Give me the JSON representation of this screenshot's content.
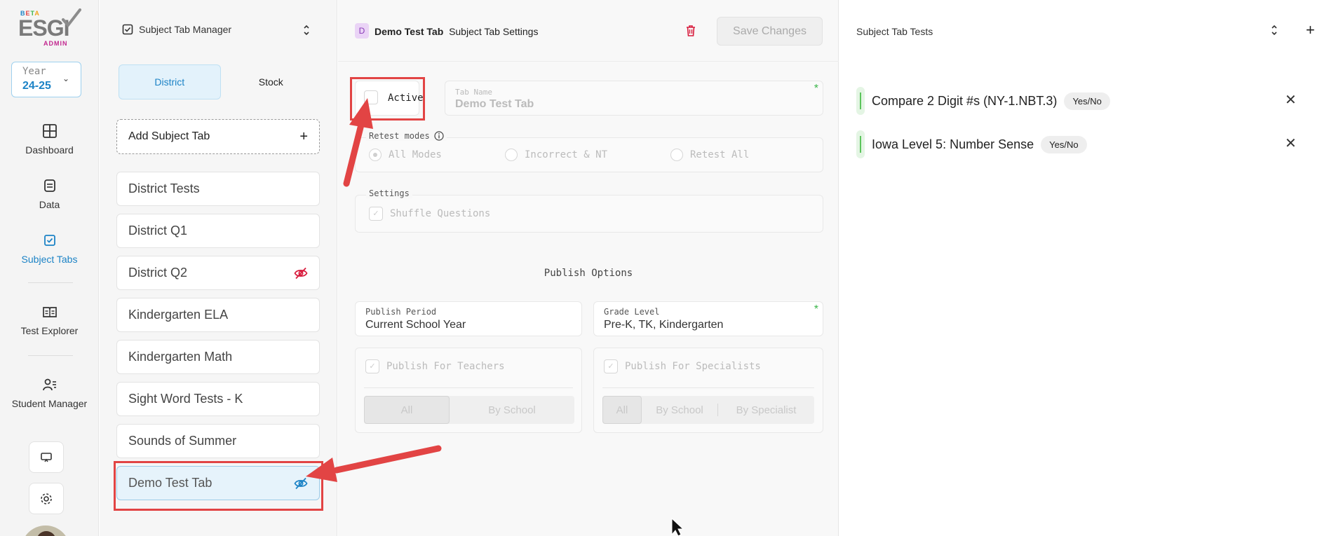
{
  "logo": {
    "beta": "BETA",
    "brand": "ESGI",
    "admin": "ADMIN"
  },
  "year": {
    "label": "Year",
    "value": "24-25"
  },
  "nav": {
    "dashboard": "Dashboard",
    "data": "Data",
    "subject_tabs": "Subject Tabs",
    "test_explorer": "Test Explorer",
    "student_manager": "Student Manager"
  },
  "list_panel": {
    "title": "Subject Tab Manager",
    "segments": {
      "district": "District",
      "stock": "Stock"
    },
    "add_label": "Add Subject Tab",
    "add_icon": "+",
    "items": [
      {
        "label": "District Tests",
        "hidden": false
      },
      {
        "label": "District Q1",
        "hidden": false
      },
      {
        "label": "District Q2",
        "hidden": true
      },
      {
        "label": "Kindergarten ELA",
        "hidden": false
      },
      {
        "label": "Kindergarten Math",
        "hidden": false
      },
      {
        "label": "Sight Word Tests - K",
        "hidden": false
      },
      {
        "label": "Sounds of Summer",
        "hidden": false
      },
      {
        "label": "Demo Test Tab",
        "hidden": true,
        "selected": true
      }
    ]
  },
  "settings": {
    "badge": "D",
    "tab_name": "Demo Test Tab",
    "header_suffix": "Subject Tab Settings",
    "save_label": "Save Changes",
    "active_label": "Active",
    "tab_name_label": "Tab Name",
    "tab_name_value": "Demo Test Tab",
    "required_mark": "*",
    "retest_label": "Retest modes",
    "retest_options": [
      "All Modes",
      "Incorrect & NT",
      "Retest All"
    ],
    "settings_label": "Settings",
    "shuffle_label": "Shuffle Questions",
    "publish_options_label": "Publish Options",
    "publish_period_label": "Publish Period",
    "publish_period_value": "Current School Year",
    "grade_level_label": "Grade Level",
    "grade_level_value": "Pre-K, TK, Kindergarten",
    "publish_teachers_label": "Publish For Teachers",
    "publish_specialists_label": "Publish For Specialists",
    "teacher_segments": [
      "All",
      "By School"
    ],
    "specialist_segments": [
      "All",
      "By School",
      "By Specialist"
    ]
  },
  "tests_panel": {
    "title": "Subject Tab Tests",
    "tests": [
      {
        "name": "Compare 2 Digit #s (NY-1.NBT.3)",
        "type": "Yes/No"
      },
      {
        "name": "Iowa Level 5: Number Sense",
        "type": "Yes/No"
      }
    ]
  },
  "colors": {
    "accent": "#1c83c6",
    "highlight": "#e24444",
    "hidden_icon_red": "#d81b3c",
    "success": "#3bb54a"
  }
}
